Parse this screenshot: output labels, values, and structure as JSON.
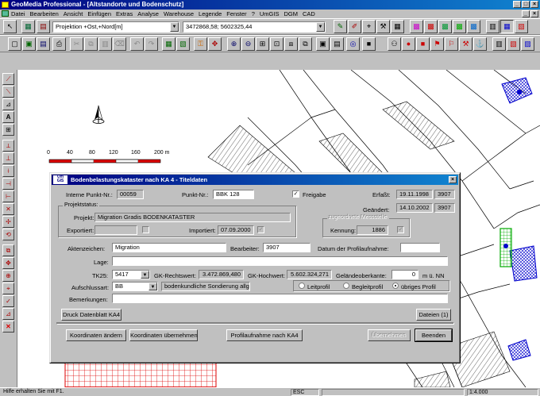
{
  "window": {
    "title": "GeoMedia Professional - [Altstandorte und Bodenschutz]"
  },
  "menu": [
    "Datei",
    "Bearbeiten",
    "Ansicht",
    "Einfügen",
    "Extras",
    "Analyse",
    "Warehouse",
    "Legende",
    "Fenster",
    "?",
    "UmGIS",
    "DGM",
    "CAD"
  ],
  "toolbar": {
    "projection": "Projektion +Ost,+Nord[m]",
    "coords": "3472868,58; 5602325,44"
  },
  "scalebar": {
    "labels": [
      "0",
      "40",
      "80",
      "120",
      "160",
      "200 m"
    ]
  },
  "dialog": {
    "title": "Bodenbelastungskataster nach KA 4 - Titeldaten",
    "logo": "Um GIS",
    "interne_punkt_label": "Interne Punkt-Nr.:",
    "interne_punkt": "00059",
    "punkt_label": "Punkt-Nr.:",
    "punkt": "BBK 128",
    "freigabe_label": "Freigabe",
    "erfasst_label": "Erfaßt:",
    "erfasst_date": "19.11.1998",
    "erfasst_id": "3907",
    "geaendert_label": "Geändert:",
    "geaendert_date": "14.10.2002",
    "geaendert_id": "3907",
    "projektstatus_label": "Projektstatus:",
    "projekt_label": "Projekt:",
    "projekt": "Migration Gradis BODENKATASTER",
    "exportiert_label": "Exportiert:",
    "importiert_label": "Importiert:",
    "importiert": "07.09.2000",
    "messstelle_label": "zugeordnete Messstelle",
    "kennung_label": "Kennung:",
    "kennung": "1886",
    "aktenzeichen_label": "Aktenzeichen:",
    "aktenzeichen": "Migration",
    "bearbeiter_label": "Bearbeiter:",
    "bearbeiter": "3907",
    "datum_label": "Datum der Profilaufnahme:",
    "lage_label": "Lage:",
    "tk25_label": "TK25:",
    "tk25": "5417",
    "gk_rechts_label": "GK-Rechtswert:",
    "gk_rechts": "3.472.869,480",
    "gk_hoch_label": "GK-Hochwert:",
    "gk_hoch": "5.602.324,271",
    "gelaende_label": "Geländeoberkante:",
    "gelaende": "0",
    "gelaende_unit": "m ü. NN",
    "aufschluss_label": "Aufschlussart:",
    "aufschluss": "BB",
    "aufschluss_desc": "bodenkundliche Sondierung allgem.",
    "radio": [
      "Leitprofil",
      "Begleitprofil",
      "übriges Profil"
    ],
    "bemerkungen_label": "Bemerkungen:",
    "btn_druck": "Druck Datenblatt KA4",
    "btn_dateien": "Dateien (1)",
    "btn_koord_aendern": "Koordinaten ändern",
    "btn_koord_uebernehmen": "Koordinaten übernehmen",
    "btn_profil": "Profilaufnahme nach KA4",
    "btn_uebernehmen": "Übernehmen",
    "btn_beenden": "Beenden"
  },
  "status": {
    "help": "Hilfe erhalten Sie mit F1.",
    "key": "ESC",
    "scale": "1:4.000"
  }
}
